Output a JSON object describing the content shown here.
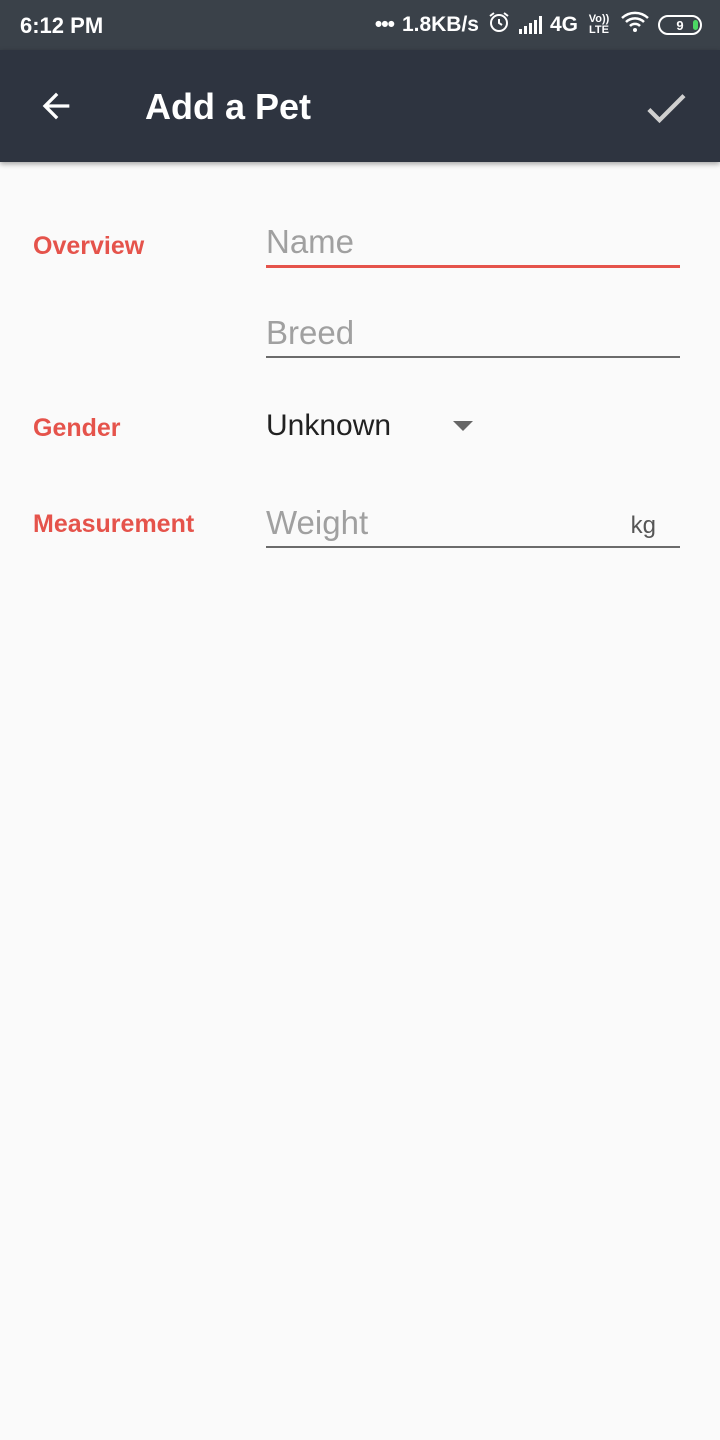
{
  "status_bar": {
    "time": "6:12 PM",
    "network_speed": "1.8KB/s",
    "network_type": "4G",
    "volte_label": "Vo)) LTE",
    "battery_level": "9",
    "icons": [
      "alarm-icon",
      "signal-icon",
      "wifi-icon",
      "battery-icon"
    ]
  },
  "toolbar": {
    "title": "Add a Pet",
    "back_icon": "arrow-back-icon",
    "save_icon": "check-icon"
  },
  "form": {
    "overview_label": "Overview",
    "name_placeholder": "Name",
    "name_value": "",
    "breed_placeholder": "Breed",
    "breed_value": "",
    "gender_label": "Gender",
    "gender_value": "Unknown",
    "measurement_label": "Measurement",
    "weight_placeholder": "Weight",
    "weight_value": "",
    "weight_unit": "kg"
  },
  "colors": {
    "accent": "#e5534b",
    "toolbar": "#2e3440",
    "status_bar": "#3a4149",
    "background": "#fafafa"
  }
}
